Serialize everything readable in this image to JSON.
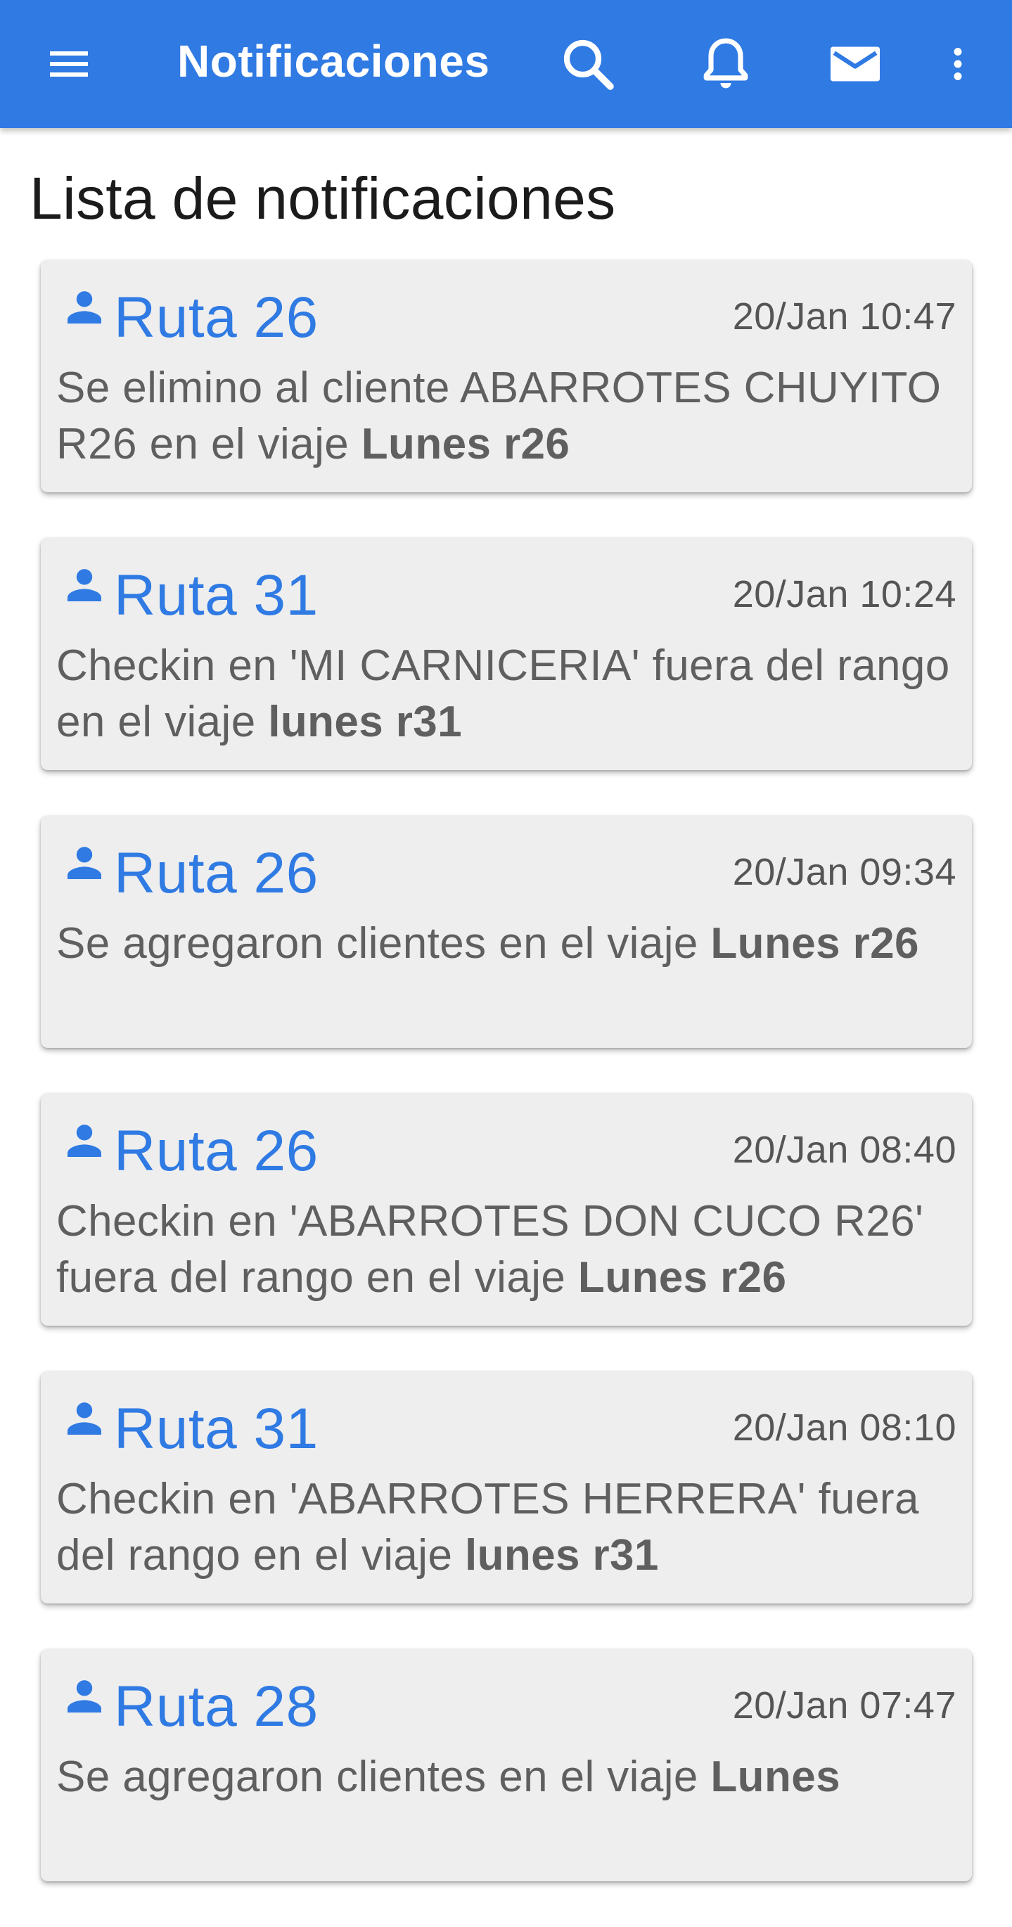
{
  "appbar": {
    "title": "Notificaciones",
    "background": "#2f7ae3",
    "icons": {
      "menu": "hamburger-menu-icon",
      "search": "search-icon",
      "notifications": "bell-icon",
      "messages": "mail-icon",
      "more": "more-vert-icon"
    }
  },
  "page": {
    "title": "Lista de notificaciones"
  },
  "notifications": [
    {
      "route": "Ruta 26",
      "time": "20/Jan 10:47",
      "message": "Se elimino al cliente ABARROTES CHUYITO R26 en el viaje ",
      "trip": "Lunes r26"
    },
    {
      "route": "Ruta 31",
      "time": "20/Jan 10:24",
      "message": "Checkin en 'MI CARNICERIA' fuera del rango en el viaje ",
      "trip": "lunes r31"
    },
    {
      "route": "Ruta 26",
      "time": "20/Jan 09:34",
      "message": "Se agregaron clientes en el viaje ",
      "trip": "Lunes r26"
    },
    {
      "route": "Ruta 26",
      "time": "20/Jan 08:40",
      "message": "Checkin en 'ABARROTES DON CUCO R26' fuera del rango en el viaje ",
      "trip": "Lunes r26"
    },
    {
      "route": "Ruta 31",
      "time": "20/Jan 08:10",
      "message": "Checkin en 'ABARROTES HERRERA' fuera del rango en el viaje ",
      "trip": "lunes r31"
    },
    {
      "route": "Ruta 28",
      "time": "20/Jan 07:47",
      "message": "Se agregaron clientes en el viaje ",
      "trip": "Lunes"
    }
  ]
}
